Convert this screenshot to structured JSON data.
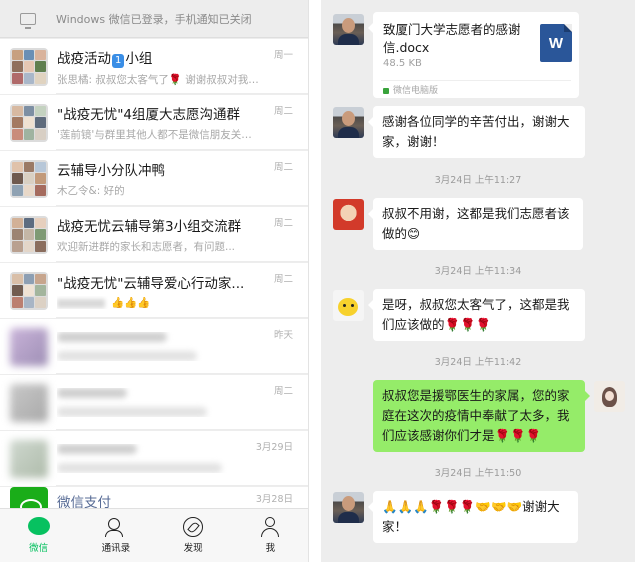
{
  "left_panel": {
    "notice": "Windows 微信已登录，手机通知已关闭",
    "chats": [
      {
        "name_prefix": "战疫活动",
        "badge": "1",
        "name_suffix": "小组",
        "preview": "张思橘: 叔叔您太客气了🌹 谢谢叔叔对我们...",
        "time": "周一"
      },
      {
        "name": "\"战疫无忧\"4组厦大志愿沟通群",
        "preview": "'莲前镜'与群里其他人都不是微信朋友关系，...",
        "time": "周二"
      },
      {
        "name": "云辅导小分队冲鸭",
        "preview": "木乙令&: 好的",
        "time": "周二"
      },
      {
        "name": "战疫无忧云辅导第3小组交流群",
        "preview": "欢迎新进群的家长和志愿者，有问题...",
        "time": "周二"
      },
      {
        "name": "\"战疫无忧\"云辅导爱心行动家...",
        "preview": "👍👍👍",
        "time": "周二"
      }
    ],
    "blurred_times": [
      "昨天",
      "周二",
      "3月29日",
      "3月28日"
    ],
    "pay": {
      "name": "微信支付"
    },
    "tabs": [
      {
        "label": "微信",
        "icon": "chat-icon",
        "active": true
      },
      {
        "label": "通讯录",
        "icon": "contacts-icon",
        "active": false
      },
      {
        "label": "发现",
        "icon": "compass-icon",
        "active": false
      },
      {
        "label": "我",
        "icon": "me-icon",
        "active": false
      }
    ]
  },
  "conversation": {
    "file": {
      "name": "致厦门大学志愿者的感谢信.docx",
      "size": "48.5 KB",
      "source": "微信电脑版",
      "icon_letter": "W"
    },
    "messages": [
      {
        "from": "other",
        "text": "感谢各位同学的辛苦付出，谢谢大家，谢谢！"
      },
      {
        "time": "3月24日 上午11:27"
      },
      {
        "from": "red",
        "text": "叔叔不用谢，这都是我们志愿者该做的😊"
      },
      {
        "time": "3月24日 上午11:34"
      },
      {
        "from": "pika",
        "text": "是呀，叔叔您太客气了，这都是我们应该做的🌹🌹🌹"
      },
      {
        "time": "3月24日 上午11:42"
      },
      {
        "from": "me",
        "text": "叔叔您是援鄂医生的家属，您的家庭在这次的疫情中奉献了太多，我们应该感谢你们才是🌹🌹🌹"
      },
      {
        "time": "3月24日 上午11:50"
      },
      {
        "from": "other",
        "text": "🙏🙏🙏🌹🌹🌹🤝🤝🤝谢谢大家！"
      }
    ]
  },
  "colors": {
    "wechat_green": "#07c160",
    "bubble_green": "#95ec69",
    "background": "#ededed"
  }
}
